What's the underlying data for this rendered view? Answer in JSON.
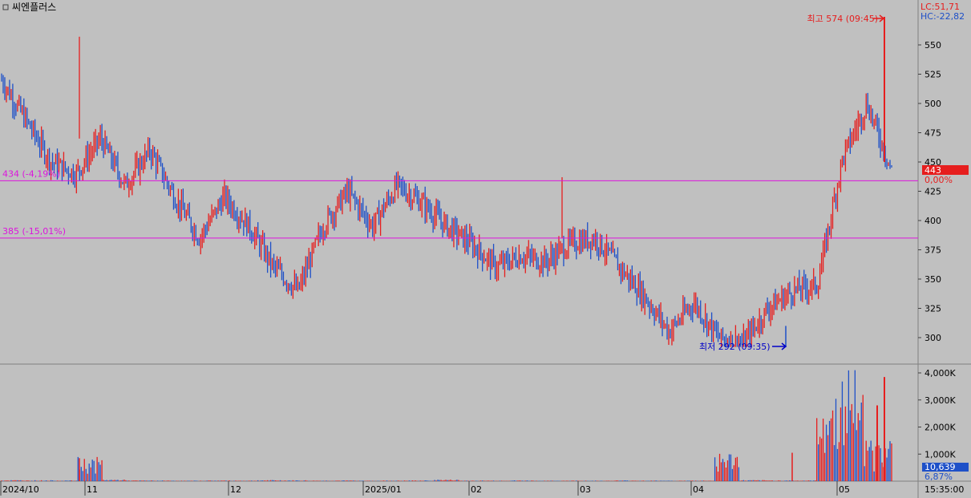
{
  "title": "씨엔플러스",
  "lc_text": "LC:51,71",
  "hc_text": "HC:-22,82",
  "price_axis": {
    "ticks": [
      "550",
      "525",
      "500",
      "475",
      "450",
      "425",
      "400",
      "375",
      "350",
      "325",
      "300"
    ]
  },
  "volume_axis": {
    "ticks": [
      "4,000K",
      "3,000K",
      "2,000K",
      "1,000K"
    ]
  },
  "x_labels": [
    "2024/10",
    "11",
    "12",
    "2025/01",
    "02",
    "03",
    "04",
    "05"
  ],
  "time_label": "15:35:00",
  "current_price": "443",
  "current_change": "0,00%",
  "current_volume": "10,639",
  "volume_pct": "6,87%",
  "high_annotation": "최고 574 (09:45)",
  "low_annotation": "최저 292 (09:35)",
  "levels": [
    {
      "label": "434 (-4,19%)",
      "value": 434
    },
    {
      "label": "385 (-15,01%)",
      "value": 385
    }
  ],
  "colors": {
    "up": "#e61e1e",
    "down": "#1e50c8",
    "level": "#dc14dc",
    "background": "#c0c0c0"
  },
  "chart_data": {
    "type": "line",
    "title": "씨엔플러스",
    "ylim": [
      280,
      580
    ],
    "x": [
      "2024/10",
      "",
      "",
      "",
      "",
      "11",
      "",
      "",
      "",
      "12",
      "",
      "",
      "",
      "2025/01",
      "",
      "",
      "",
      "02",
      "",
      "",
      "",
      "03",
      "",
      "",
      "",
      "04",
      "",
      "",
      "",
      "",
      "05",
      "",
      "",
      "",
      ""
    ],
    "series": [
      {
        "values": [
          520,
          485,
          450,
          440,
          470,
          430,
          460,
          420,
          385,
          420,
          395,
          360,
          340,
          395,
          425,
          395,
          430,
          415,
          395,
          380,
          360,
          370,
          365,
          380,
          385,
          360,
          335,
          305,
          330,
          300,
          295,
          325,
          340,
          345,
          452,
          500,
          443
        ]
      }
    ],
    "volume": [
      40,
      35,
      30,
      900,
      60,
      30,
      25,
      20,
      30,
      25,
      40,
      35,
      25,
      30,
      20,
      25,
      30,
      60,
      25,
      25,
      30,
      20,
      25,
      20,
      30,
      25,
      20,
      25,
      1100,
      40,
      35,
      30,
      3300,
      4300,
      1700,
      800
    ],
    "high": 574,
    "low": 292,
    "volume_ylim": [
      0,
      4200
    ]
  }
}
